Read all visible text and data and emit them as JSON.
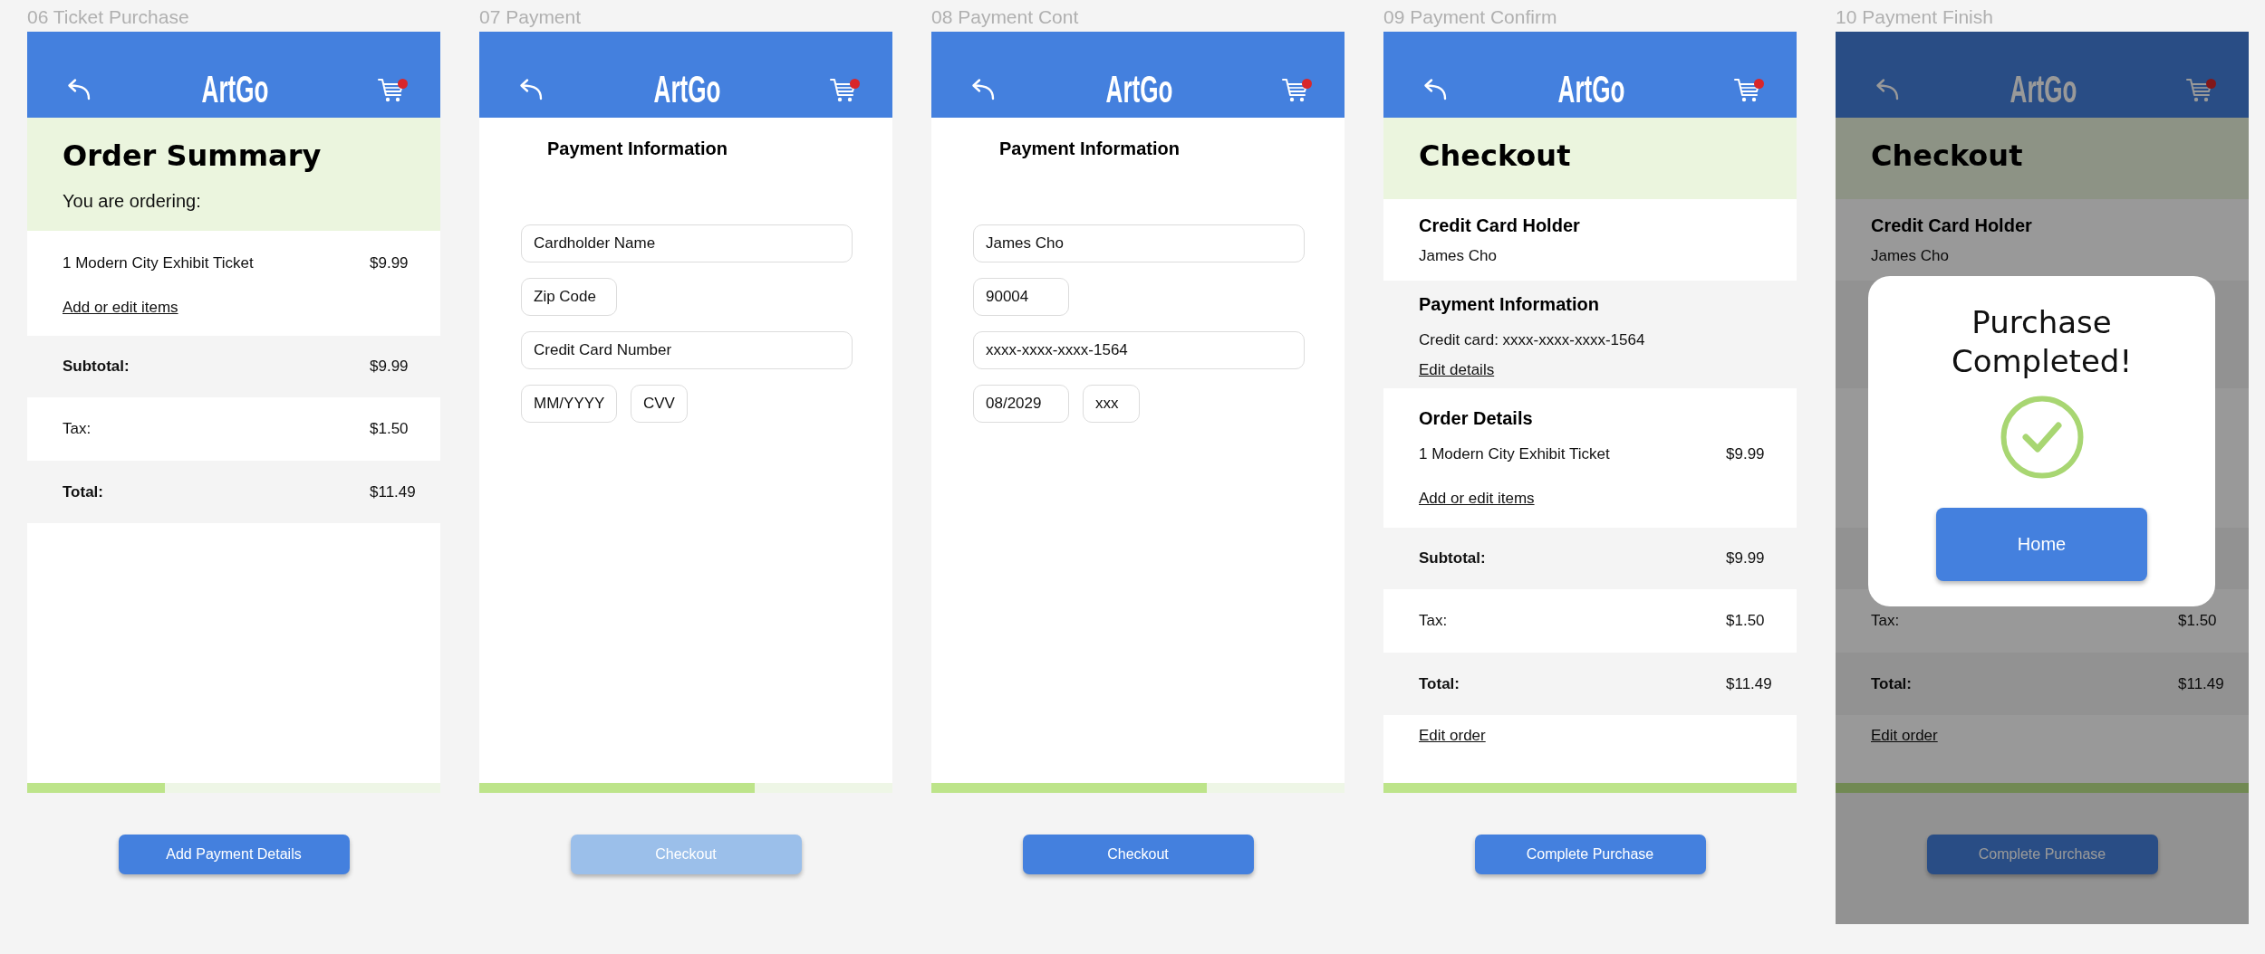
{
  "screens": [
    {
      "label": "06 Ticket Purchase",
      "logo": "ArtGo",
      "sections": [
        {
          "kind": "hero",
          "title": "Order Summary",
          "subtitle": "You are ordering:"
        },
        {
          "kind": "items",
          "items": [
            {
              "name": "1 Modern City Exhibit Ticket",
              "price": "$9.99"
            }
          ],
          "link": "Add or edit items"
        },
        {
          "kind": "subtotal",
          "label": "Subtotal:",
          "value": "$9.99"
        },
        {
          "kind": "tax",
          "label": "Tax:",
          "value": "$1.50"
        },
        {
          "kind": "total",
          "label": "Total:",
          "value": "$11.49"
        }
      ],
      "progress": {
        "level": 0.333
      },
      "button": {
        "label": "Add Payment Details",
        "disabled": false
      }
    },
    {
      "label": "07 Payment",
      "logo": "ArtGo",
      "sections": [
        {
          "kind": "form",
          "heading": "Payment Information",
          "rows": [
            {
              "fields": [
                {
                  "kind": "wide",
                  "placeholder": "Cardholder Name"
                }
              ]
            },
            {
              "fields": [
                {
                  "kind": "short",
                  "placeholder": "Zip Code"
                }
              ]
            },
            {
              "fields": [
                {
                  "kind": "wide",
                  "placeholder": "Credit Card Number"
                }
              ]
            },
            {
              "fields": [
                {
                  "kind": "short",
                  "placeholder": "MM/YYYY"
                },
                {
                  "kind": "mini",
                  "placeholder": "CVV"
                }
              ]
            }
          ]
        }
      ],
      "progress": {
        "level": 0.667
      },
      "button": {
        "label": "Checkout",
        "disabled": true
      }
    },
    {
      "label": "08 Payment Cont",
      "logo": "ArtGo",
      "sections": [
        {
          "kind": "form",
          "heading": "Payment Information",
          "rows": [
            {
              "fields": [
                {
                  "kind": "wide",
                  "value": "James Cho"
                }
              ]
            },
            {
              "fields": [
                {
                  "kind": "short",
                  "value": "90004"
                }
              ]
            },
            {
              "fields": [
                {
                  "kind": "wide",
                  "value": "xxxx-xxxx-xxxx-1564"
                }
              ]
            },
            {
              "fields": [
                {
                  "kind": "short",
                  "value": "08/2029"
                },
                {
                  "kind": "mini",
                  "value": "xxx"
                }
              ]
            }
          ]
        }
      ],
      "progress": {
        "level": 0.667
      },
      "button": {
        "label": "Checkout",
        "disabled": false
      }
    },
    {
      "label": "09 Payment Confirm",
      "logo": "ArtGo",
      "sections": [
        {
          "kind": "hero",
          "title": "Checkout"
        },
        {
          "kind": "holder",
          "heading": "Credit Card Holder",
          "lines": [
            "James Cho"
          ]
        },
        {
          "kind": "payment",
          "heading": "Payment Information",
          "lines": [
            "Credit card: xxxx-xxxx-xxxx-1564"
          ],
          "link": "Edit details"
        },
        {
          "kind": "order",
          "heading": "Order Details",
          "items": [
            {
              "name": "1 Modern City Exhibit Ticket",
              "price": "$9.99"
            }
          ],
          "link": "Add or edit items"
        },
        {
          "kind": "subtotal",
          "label": "Subtotal:",
          "value": "$9.99"
        },
        {
          "kind": "tax",
          "label": "Tax:",
          "value": "$1.50"
        },
        {
          "kind": "total",
          "label": "Total:",
          "value": "$11.49"
        },
        {
          "kind": "edit",
          "link": "Edit order"
        }
      ],
      "progress": {
        "level": 1
      },
      "button": {
        "label": "Complete Purchase",
        "disabled": false
      }
    },
    {
      "label": "10 Payment Finish",
      "logo": "ArtGo",
      "sections": [
        {
          "kind": "hero",
          "title": "Checkout"
        },
        {
          "kind": "holder",
          "heading": "Credit Card Holder",
          "lines": [
            "James Cho"
          ]
        },
        {
          "kind": "payment"
        },
        {
          "kind": "order"
        },
        {
          "kind": "subtotal"
        },
        {
          "kind": "tax",
          "label": "Tax:",
          "value": "$1.50"
        },
        {
          "kind": "total",
          "label": "Total:",
          "value": "$11.49"
        },
        {
          "kind": "edit",
          "link": "Edit order"
        }
      ],
      "progress": {
        "level": 1
      },
      "button": {
        "label": "Complete Purchase",
        "disabled": false
      },
      "dialog": {
        "title": "Purchase Completed!",
        "button": "Home"
      }
    }
  ]
}
